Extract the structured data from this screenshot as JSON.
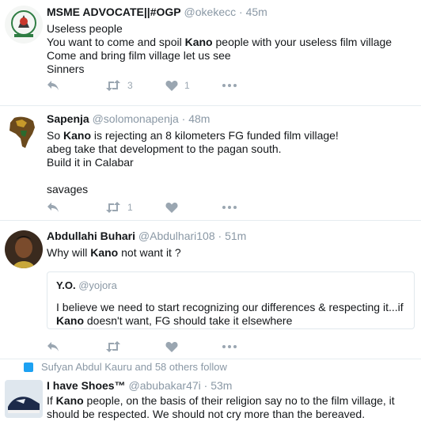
{
  "tweets": [
    {
      "name": "MSME ADVOCATE||#OGP",
      "handle": "@okekecc",
      "time": "45m",
      "lines": [
        "Useless people",
        "You want to come and spoil Kano people with your useless film village",
        "Come and bring film village let us see",
        "Sinners"
      ],
      "retweets": "3",
      "likes": "1"
    },
    {
      "name": "Sapenja",
      "handle": "@solomonapenja",
      "time": "48m",
      "lines": [
        "So Kano is rejecting an 8 kilometers FG funded film village!",
        "abeg take that development to the pagan south.",
        "Build it in Calabar",
        "",
        "savages"
      ],
      "retweets": "1",
      "likes": ""
    },
    {
      "name": "Abdullahi Buhari",
      "handle": "@Abdulhari108",
      "time": "51m",
      "lines": [
        "Why will Kano not want it ?"
      ],
      "quote": {
        "name": "Y.O.",
        "handle": "@yojora",
        "text": "I believe we need to start recognizing our differences & respecting it...if Kano doesn't want, FG should take it elsewhere"
      },
      "retweets": "",
      "likes": ""
    },
    {
      "follow_note": "Sufyan Abdul Kauru and 58 others follow",
      "name": "I have Shoes™",
      "handle": "@abubakar47i",
      "time": "53m",
      "lines": [
        "If Kano people, on the basis of their religion say no to the film village, it should be respected. We should not cry more than the bereaved."
      ]
    }
  ],
  "colors": {
    "text": "#14171a",
    "muted": "#8a98a5",
    "icon": "#9aa6b1",
    "border": "#e6ecf0",
    "accent": "#1da1f2"
  }
}
